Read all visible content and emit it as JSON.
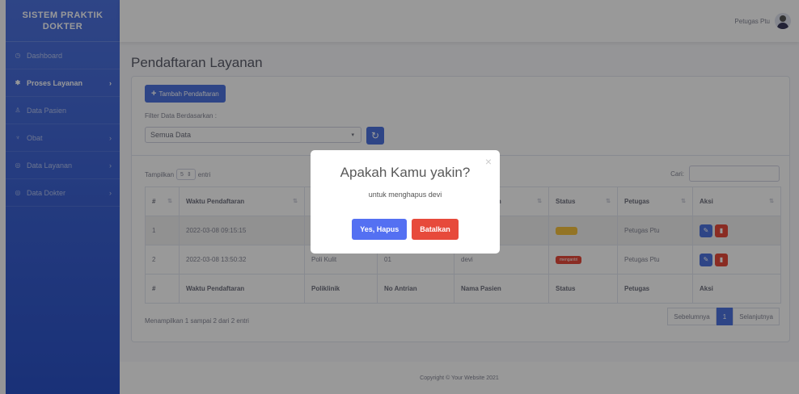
{
  "colors": {
    "primary": "#4e73df",
    "danger": "#e74a3b",
    "warning": "#f6c23e",
    "confirm": "#5470f2"
  },
  "sidebar": {
    "brand_line1": "SISTEM PRAKTIK",
    "brand_line2": "DOKTER",
    "items": [
      {
        "label": "Dashboard",
        "icon": "dashboard-icon",
        "active": false,
        "has_chevron": false
      },
      {
        "label": "Proses Layanan",
        "icon": "gear-icon",
        "active": true,
        "has_chevron": true
      },
      {
        "label": "Data Pasien",
        "icon": "user-icon",
        "active": false,
        "has_chevron": false
      },
      {
        "label": "Obat",
        "icon": "pill-icon",
        "active": false,
        "has_chevron": true
      },
      {
        "label": "Data Layanan",
        "icon": "service-icon",
        "active": false,
        "has_chevron": true
      },
      {
        "label": "Data Dokter",
        "icon": "doctor-icon",
        "active": false,
        "has_chevron": true
      }
    ]
  },
  "topbar": {
    "user_name": "Petugas Ptu"
  },
  "page": {
    "title": "Pendaftaran Layanan"
  },
  "card": {
    "add_button": "Tambah Pendaftaran",
    "filter_label": "Filter Data Berdasarkan :",
    "filter_value": "Semua Data",
    "show_prefix": "Tampilkan",
    "show_value": "5",
    "show_suffix": "entri",
    "search_label": "Cari:",
    "info": "Menampilkan 1 sampai 2 dari 2 entri",
    "pager": {
      "prev": "Sebelumnya",
      "current": "1",
      "next": "Selanjutnya"
    }
  },
  "table": {
    "headers": [
      "#",
      "Waktu Pendaftaran",
      "Poliklinik",
      "No Antrian",
      "Nama Pasien",
      "Status",
      "Petugas",
      "Aksi"
    ],
    "rows": [
      {
        "no": "1",
        "waktu": "2022-03-08 09:15:15",
        "poli": "",
        "antrian": "",
        "nama": "",
        "status": "",
        "petugas": "Petugas Ptu"
      },
      {
        "no": "2",
        "waktu": "2022-03-08 13:50:32",
        "poli": "Poli Kulit",
        "antrian": "01",
        "nama": "devi",
        "status": "mengantri",
        "petugas": "Petugas Ptu"
      }
    ]
  },
  "footer": {
    "text": "Copyright © Your Website 2021"
  },
  "modal": {
    "title": "Apakah Kamu yakin?",
    "text": "untuk menghapus devi",
    "confirm": "Yes, Hapus",
    "cancel": "Batalkan",
    "close": "×"
  }
}
